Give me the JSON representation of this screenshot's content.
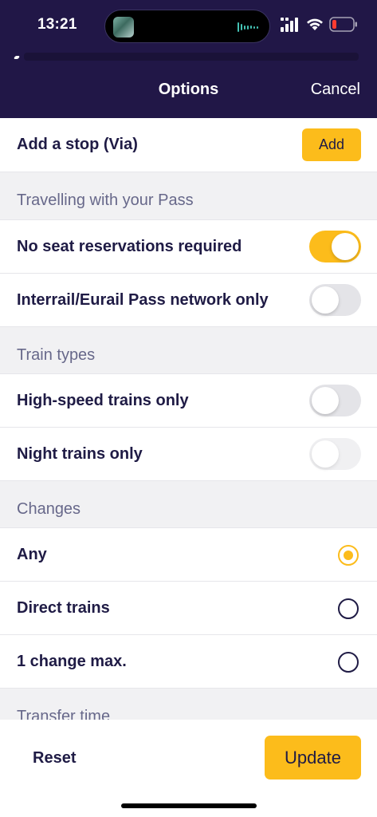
{
  "status_bar": {
    "time": "13:21",
    "signal_icon": "cellular-signal-icon",
    "wifi_icon": "wifi-icon",
    "battery_icon": "battery-low-icon",
    "battery_color": "#ff3b30"
  },
  "header": {
    "title": "Options",
    "cancel_label": "Cancel",
    "background": "#211747"
  },
  "via": {
    "label": "Add a stop (Via)",
    "add_label": "Add"
  },
  "sections": {
    "pass": "Travelling with your Pass",
    "train_types": "Train types",
    "changes": "Changes",
    "transfer_time": "Transfer time"
  },
  "pass_options": [
    {
      "label": "No seat reservations required",
      "on": true
    },
    {
      "label": "Interrail/Eurail Pass network only",
      "on": false
    }
  ],
  "train_type_options": [
    {
      "label": "High-speed trains only",
      "on": false
    },
    {
      "label": "Night trains only",
      "on": false
    }
  ],
  "change_options": [
    {
      "label": "Any",
      "selected": true
    },
    {
      "label": "Direct trains",
      "selected": false
    },
    {
      "label": "1 change max.",
      "selected": false
    }
  ],
  "footer": {
    "reset_label": "Reset",
    "update_label": "Update"
  },
  "colors": {
    "accent": "#fcbc1b",
    "text": "#1f1b45",
    "section_bg": "#f1f1f3"
  }
}
